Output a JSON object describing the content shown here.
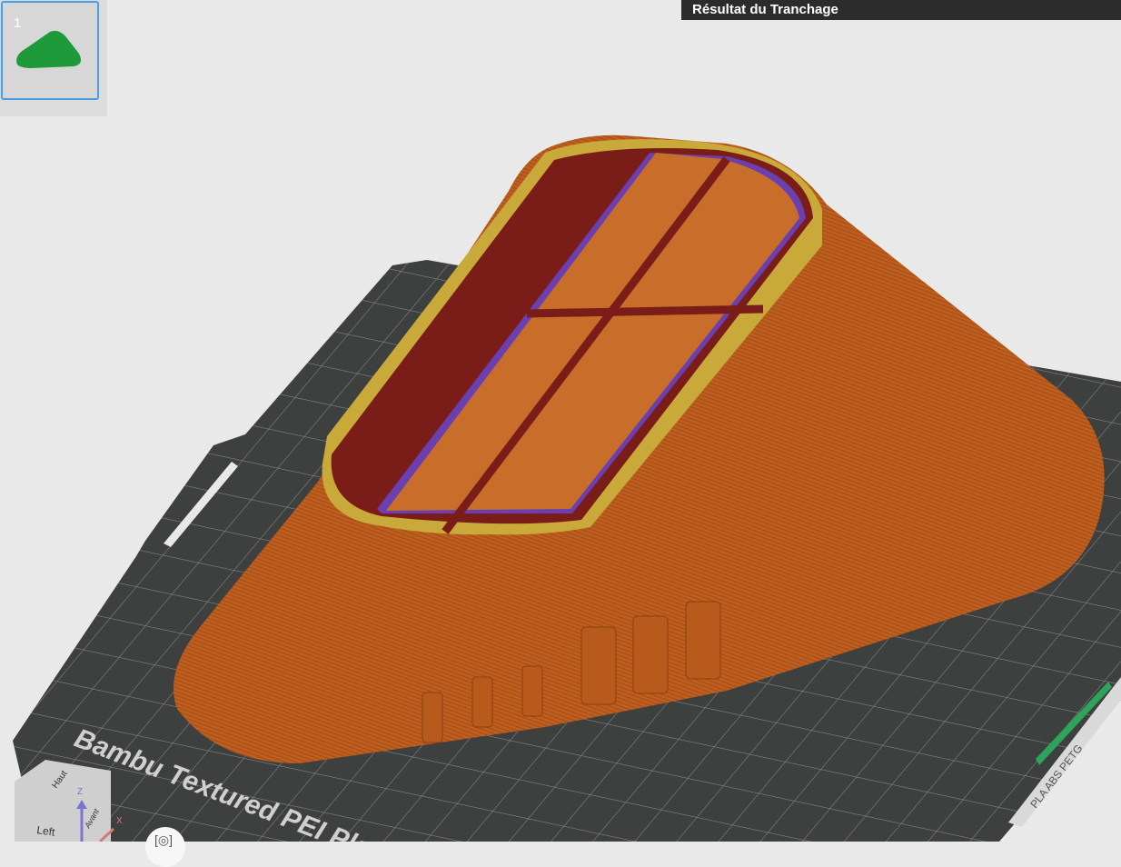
{
  "header": {
    "title": "Résultat du Tranchage"
  },
  "plates": [
    {
      "number": "1",
      "active": true
    }
  ],
  "bed": {
    "label": "Bambu Textured PEI Plate",
    "filament_label": "PLA ABS PETG"
  },
  "view_cube": {
    "top": "Haut",
    "left": "Left",
    "front": "Avant",
    "z_axis": "Z",
    "x_axis": "X"
  },
  "colors": {
    "bed": "#3e3f3f",
    "wall": "#bd5d1e",
    "inner_wall": "#d07830",
    "sparse_infill": "#7a1c18",
    "solid_infill": "#6b3fb0",
    "gap_fill": "#c9a93a",
    "accent": "#4a9ee8"
  },
  "camera_icon": "camera-fit-icon"
}
